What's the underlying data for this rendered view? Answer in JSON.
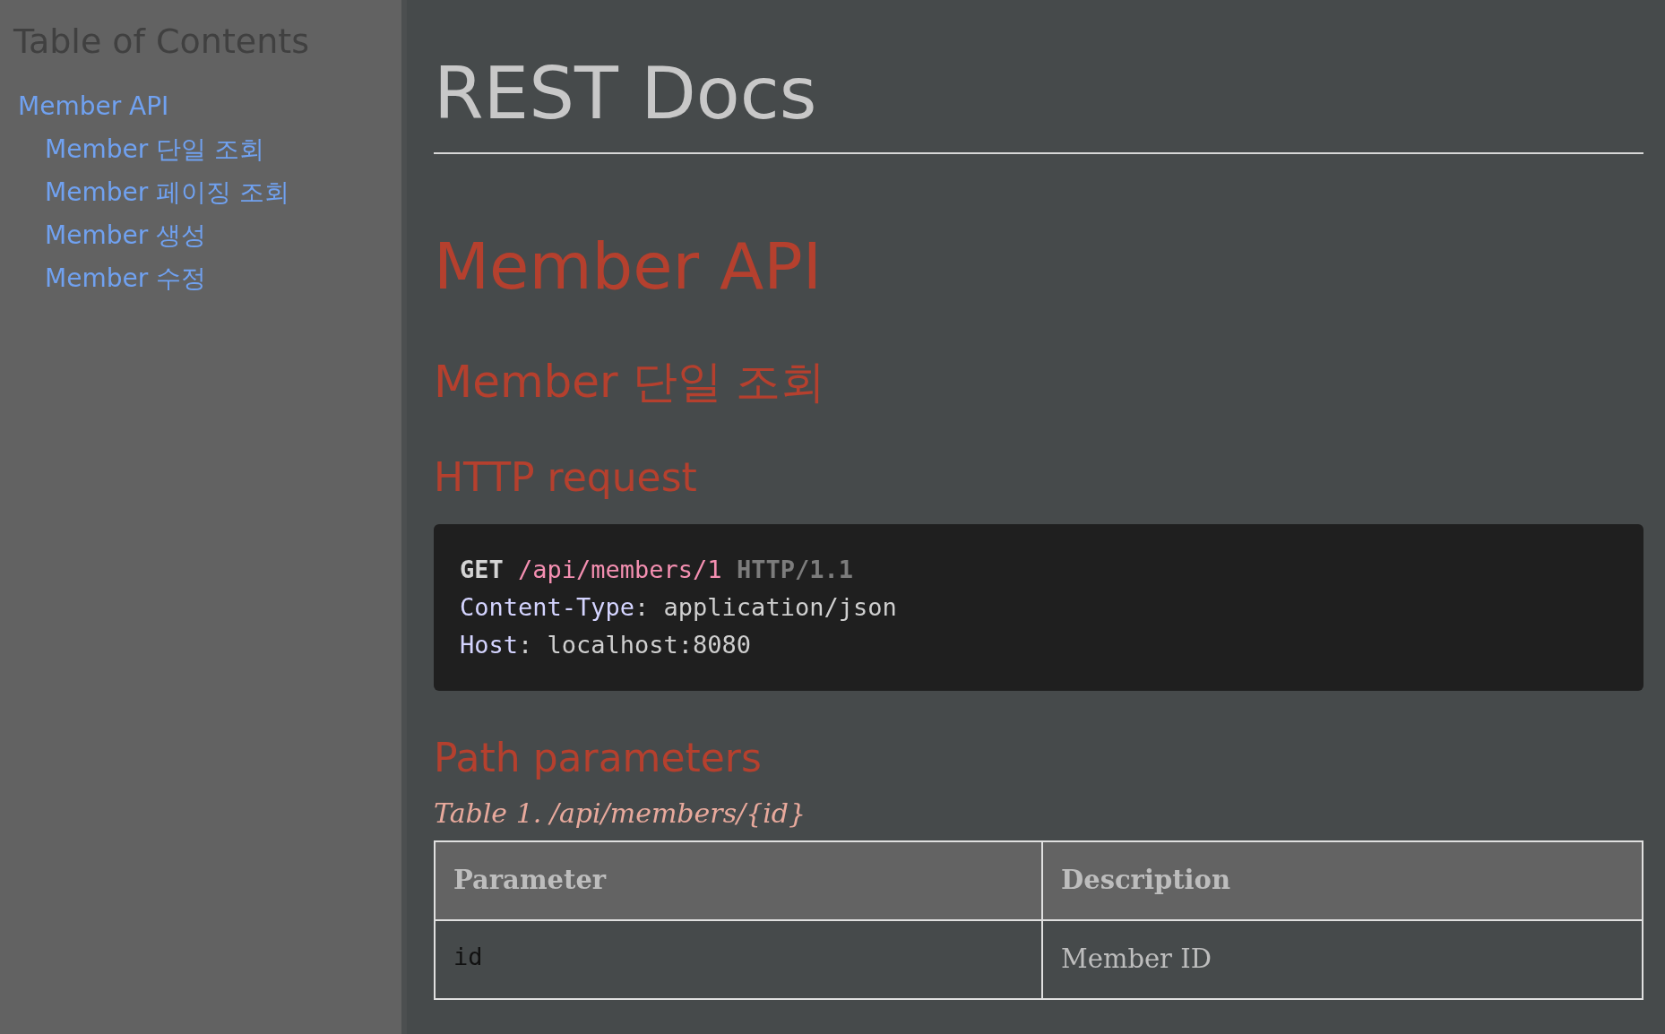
{
  "sidebar": {
    "title": "Table of Contents",
    "items": [
      {
        "label": "Member API",
        "children": [
          {
            "label": "Member 단일 조회"
          },
          {
            "label": "Member 페이징 조회"
          },
          {
            "label": "Member 생성"
          },
          {
            "label": "Member 수정"
          }
        ]
      }
    ]
  },
  "main": {
    "title": "REST Docs",
    "section": "Member API",
    "subsection": "Member 단일 조회",
    "request": {
      "heading": "HTTP request",
      "lines": [
        {
          "tokens": [
            {
              "kind": "method",
              "text": "GET"
            },
            {
              "kind": "path",
              "text": " /api/members/1 "
            },
            {
              "kind": "version",
              "text": "HTTP/1.1"
            }
          ]
        },
        {
          "tokens": [
            {
              "kind": "header",
              "text": "Content-Type"
            },
            {
              "kind": "value",
              "text": ": application/json"
            }
          ]
        },
        {
          "tokens": [
            {
              "kind": "header",
              "text": "Host"
            },
            {
              "kind": "value",
              "text": ": localhost:8080"
            }
          ]
        }
      ]
    },
    "parameters": {
      "heading": "Path parameters",
      "caption": "Table 1. /api/members/{id}",
      "columns": [
        "Parameter",
        "Description"
      ],
      "rows": [
        [
          "id",
          "Member ID"
        ]
      ]
    }
  }
}
